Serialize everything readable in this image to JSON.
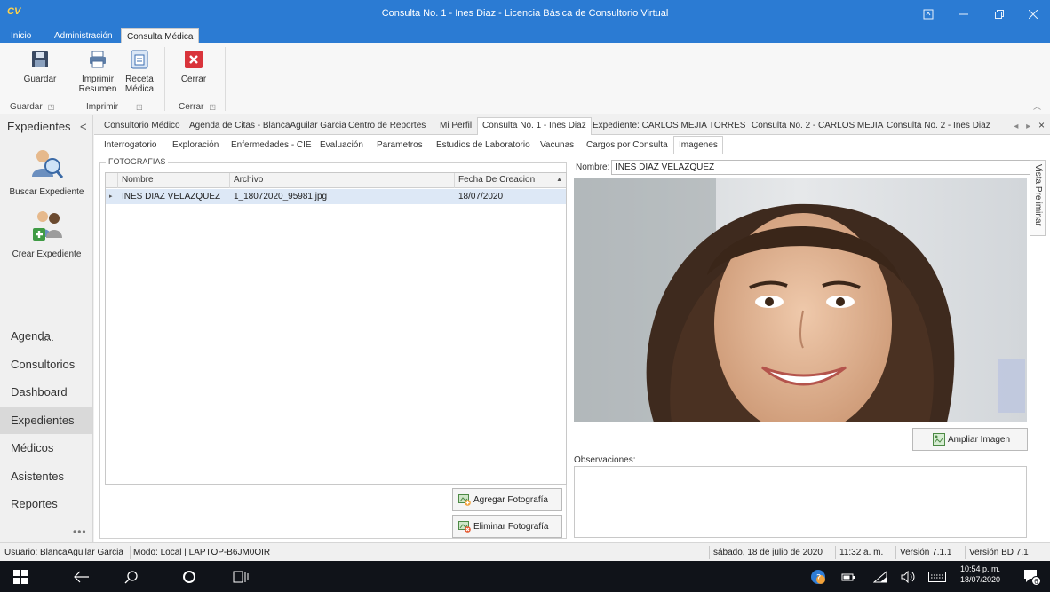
{
  "window": {
    "logo": "CV",
    "title": "Consulta No. 1 - Ines Diaz - Licencia Básica de Consultorio Virtual"
  },
  "ribbon_tabs": [
    "Inicio",
    "Administración",
    "Consulta Médica"
  ],
  "ribbon": {
    "buttons": {
      "guardar": "Guardar",
      "imprimir_resumen_1": "Imprimir",
      "imprimir_resumen_2": "Resumen",
      "receta_1": "Receta",
      "receta_2": "Médica",
      "cerrar": "Cerrar"
    },
    "groups": {
      "guardar": "Guardar",
      "imprimir": "Imprimir",
      "cerrar": "Cerrar"
    }
  },
  "leftnav": {
    "header": "Expedientes",
    "collapse": "<",
    "big_buttons": {
      "buscar": "Buscar Expediente",
      "crear": "Crear Expediente"
    },
    "dots": "......",
    "items": [
      "Agenda",
      "Consultorios",
      "Dashboard",
      "Expedientes",
      "Médicos",
      "Asistentes",
      "Reportes"
    ],
    "more": "•••"
  },
  "doc_tabs": [
    "Consultorio Médico",
    "Agenda de Citas - BlancaAguilar Garcia",
    "Centro de Reportes",
    "Mi Perfil",
    "Consulta No. 1 - Ines Diaz",
    "Expediente: CARLOS MEJIA TORRES",
    "Consulta No. 2 - CARLOS MEJIA",
    "Consulta No. 2 - Ines Diaz"
  ],
  "sub_tabs": [
    "Interrogatorio",
    "Exploración",
    "Enfermedades - CIE",
    "Evaluación",
    "Parametros",
    "Estudios de Laboratorio",
    "Vacunas",
    "Cargos por Consulta",
    "Imagenes"
  ],
  "fotografias": {
    "legend": "FOTOGRAFIAS",
    "columns": [
      "Nombre",
      "Archivo",
      "Fecha De Creacion"
    ],
    "rows": [
      {
        "nombre": "INES DIAZ VELAZQUEZ",
        "archivo": "1_18072020_95981.jpg",
        "fecha": "18/07/2020"
      }
    ],
    "agregar": "Agregar Fotografía",
    "eliminar": "Eliminar Fotografía"
  },
  "preview": {
    "nombre_label": "Nombre:",
    "nombre_value": "INES DIAZ VELAZQUEZ",
    "vista_tab": "Vista Preliminar",
    "ampliar": "Ampliar Imagen",
    "observaciones_label": "Observaciones:",
    "observaciones_value": ""
  },
  "statusbar": {
    "usuario": "Usuario: BlancaAguilar Garcia",
    "modo": "Modo: Local | LAPTOP-B6JM0OIR",
    "fecha": "sábado, 18 de julio de 2020",
    "hora": "11:32 a. m.",
    "version": "Versión  7.1.1",
    "version_bd": "Versión BD 7.1"
  },
  "taskbar": {
    "time": "10:54 p. m.",
    "date": "18/07/2020",
    "notification_count": "6"
  }
}
